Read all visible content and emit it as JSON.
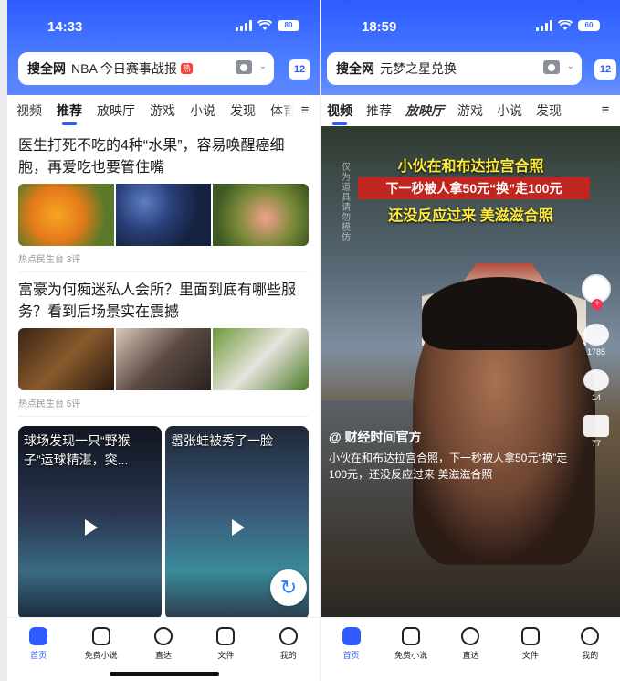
{
  "left": {
    "status": {
      "time": "14:33",
      "battery": "80"
    },
    "search": {
      "brand": "搜全网",
      "query": "NBA 今日赛事战报",
      "hot_badge": "热",
      "tab_count": "12"
    },
    "tabs": [
      "视频",
      "推荐",
      "放映厅",
      "游戏",
      "小说",
      "发现",
      "体育"
    ],
    "active_tab": "推荐",
    "articles": [
      {
        "title": "医生打死不吃的4种“水果”，容易唤醒癌细胞，再爱吃也要管住嘴",
        "meta": "热点民生台  3评"
      },
      {
        "title": "富豪为何痴迷私人会所？里面到底有哪些服务？看到后场景实在震撼",
        "meta": "热点民生台  5评"
      }
    ],
    "videos": [
      {
        "title": "球场发现一只“野猴子”运球精湛，突..."
      },
      {
        "title": "嚣张蛙被秀了一脸"
      }
    ]
  },
  "right": {
    "status": {
      "time": "18:59",
      "battery": "60"
    },
    "search": {
      "brand": "搜全网",
      "query": "元梦之星兑换",
      "tab_count": "12"
    },
    "tabs": [
      "视频",
      "推荐",
      "放映厅",
      "游戏",
      "小说",
      "发现"
    ],
    "active_tab": "视频",
    "overlay": {
      "line1": "小伙在和布达拉宫合照",
      "line2": "下一秒被人拿50元“换”走100元",
      "line3": "还没反应过来 美滋滋合照",
      "watermark": "仅为道具 请勿模仿"
    },
    "side": {
      "likes": "1785",
      "comments": "14",
      "shares": "77"
    },
    "author": "@ 财经时间官方",
    "description": "小伙在和布达拉宫合照，下一秒被人拿50元“换”走100元，还没反应过来 美滋滋合照"
  },
  "nav": [
    "首页",
    "免费小说",
    "直达",
    "文件",
    "我的"
  ]
}
